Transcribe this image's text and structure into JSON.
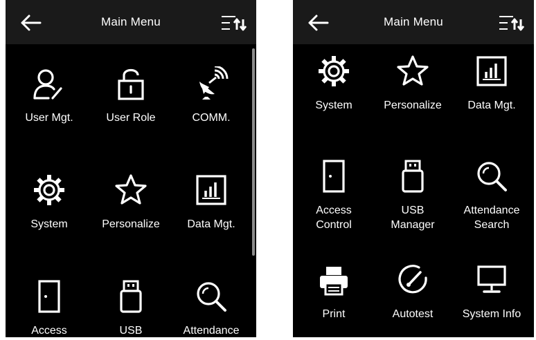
{
  "left_screen": {
    "title": "Main Menu",
    "items": [
      {
        "label": "User Mgt.",
        "icon": "user-icon"
      },
      {
        "label": "User Role",
        "icon": "lock-icon"
      },
      {
        "label": "COMM.",
        "icon": "satellite-icon"
      },
      {
        "label": "System",
        "icon": "gear-icon"
      },
      {
        "label": "Personalize",
        "icon": "star-icon"
      },
      {
        "label": "Data Mgt.",
        "icon": "chart-icon"
      },
      {
        "label": "Access",
        "icon": "door-icon"
      },
      {
        "label": "USB",
        "icon": "usb-icon"
      },
      {
        "label": "Attendance",
        "icon": "search-icon"
      }
    ]
  },
  "right_screen": {
    "title": "Main Menu",
    "items": [
      {
        "label": "System",
        "icon": "gear-icon"
      },
      {
        "label": "Personalize",
        "icon": "star-icon"
      },
      {
        "label": "Data Mgt.",
        "icon": "chart-icon"
      },
      {
        "label": "Access\nControl",
        "icon": "door-icon"
      },
      {
        "label": "USB\nManager",
        "icon": "usb-icon"
      },
      {
        "label": "Attendance\nSearch",
        "icon": "search-icon"
      },
      {
        "label": "Print",
        "icon": "printer-icon"
      },
      {
        "label": "Autotest",
        "icon": "autotest-icon"
      },
      {
        "label": "System Info",
        "icon": "monitor-icon"
      }
    ]
  },
  "colors": {
    "background": "#000000",
    "topbar": "#1a1a1a",
    "text": "#ffffff",
    "scrollbar": "#8c8c8c"
  }
}
